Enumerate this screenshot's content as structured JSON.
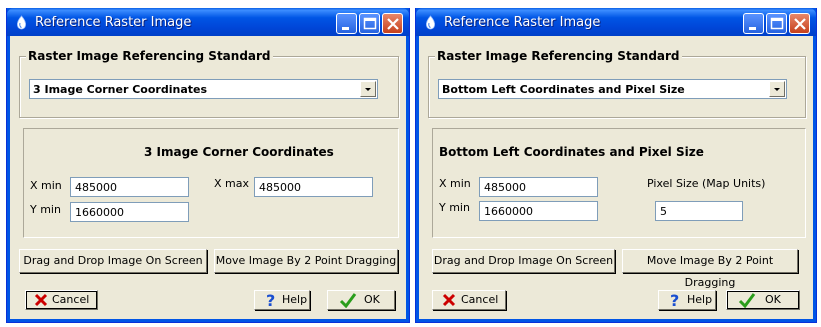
{
  "left": {
    "title": "Reference Raster Image",
    "groupbox_label": "Raster Image Referencing Standard",
    "dropdown_value": "3 Image Corner Coordinates",
    "panel_title": "3 Image Corner Coordinates",
    "xmin_label": "X min",
    "xmin_value": "485000",
    "xmax_label": "X max",
    "xmax_value": "485000",
    "ymin_label": "Y min",
    "ymin_value": "1660000",
    "drag_drop_label": "Drag and Drop Image On Screen",
    "move_image_label": "Move Image By 2 Point Dragging",
    "cancel_label": "Cancel",
    "help_label": "Help",
    "ok_label": "OK"
  },
  "right": {
    "title": "Reference Raster Image",
    "groupbox_label": "Raster Image Referencing Standard",
    "dropdown_value": "Bottom Left Coordinates and Pixel Size",
    "panel_title": "Bottom Left Coordinates and Pixel Size",
    "xmin_label": "X min",
    "xmin_value": "485000",
    "ymin_label": "Y min",
    "ymin_value": "1660000",
    "pixel_size_label": "Pixel Size (Map Units)",
    "pixel_size_value": "5",
    "drag_drop_label": "Drag and Drop Image On Screen",
    "move_image_label": "Move Image By 2 Point Dragging",
    "cancel_label": "Cancel",
    "help_label": "Help",
    "ok_label": "OK"
  },
  "colors": {
    "titlebar": "#0055e5",
    "face": "#ece9d8",
    "cancel_icon": "#cc0000",
    "ok_icon": "#2a9d1c",
    "help_icon": "#1a4fd0"
  }
}
